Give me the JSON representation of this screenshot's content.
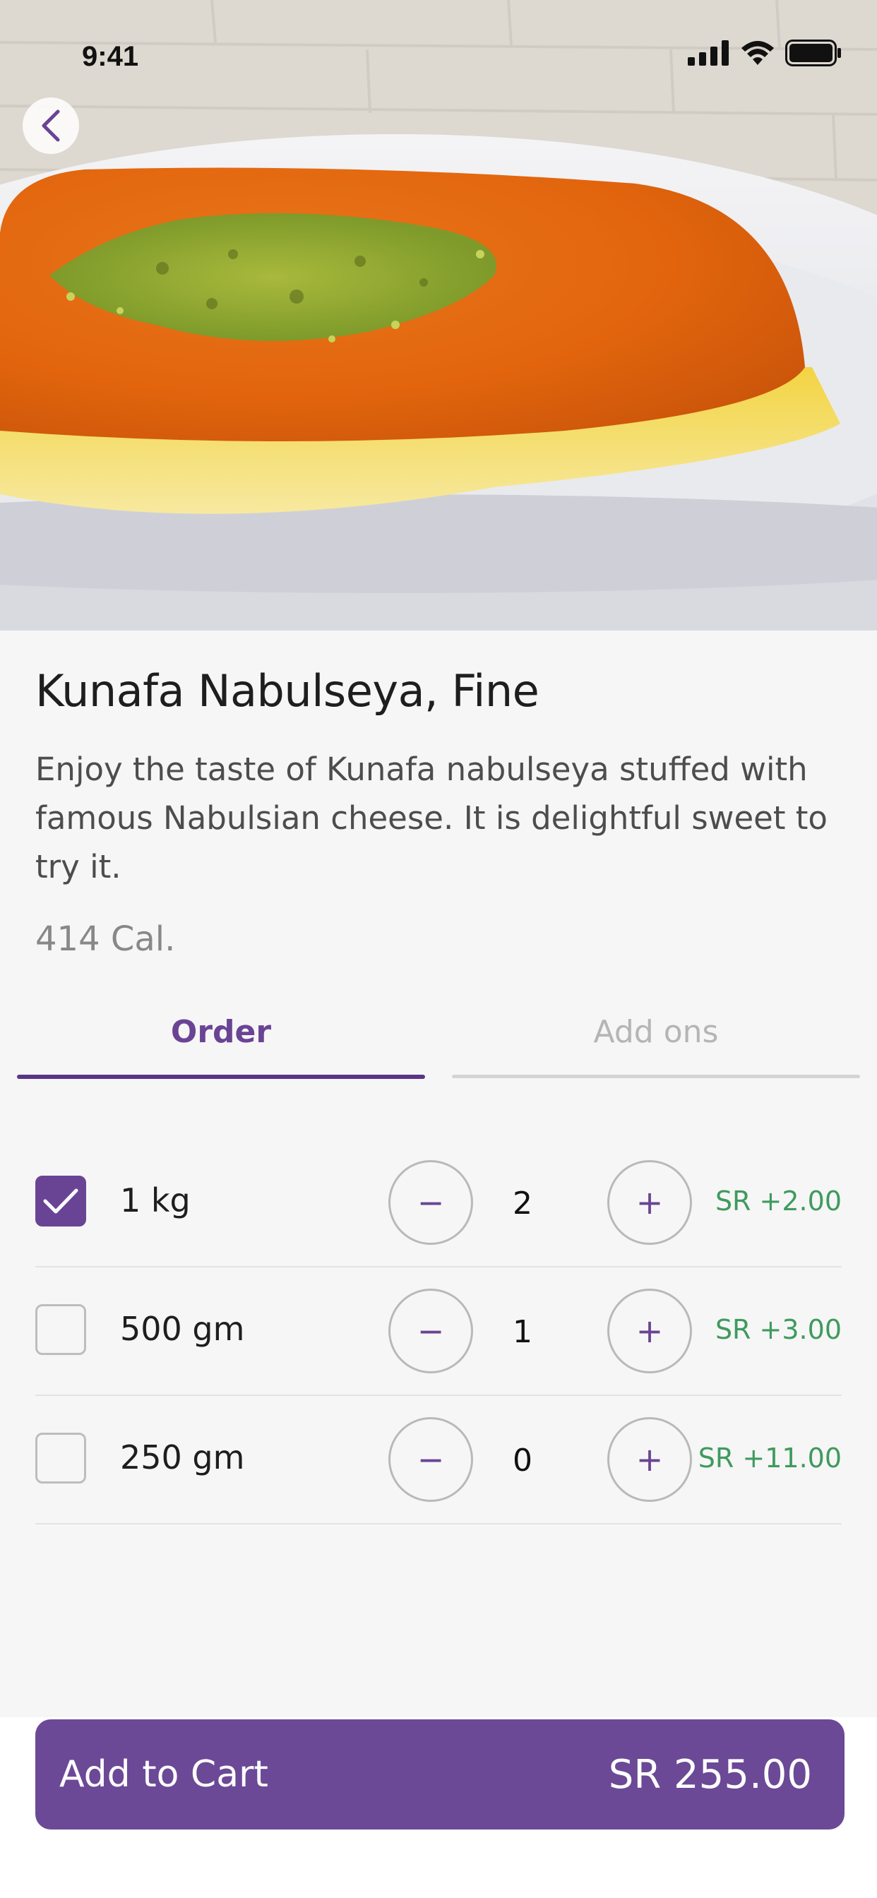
{
  "status_bar": {
    "time": "9:41"
  },
  "product": {
    "title": "Kunafa Nabulseya, Fine",
    "description": "Enjoy the taste of Kunafa nabulseya stuffed with famous  Nabulsian cheese.   It is delightful sweet to try it.",
    "calories": "414 Cal."
  },
  "tabs": [
    {
      "label": "Order",
      "active": true
    },
    {
      "label": "Add ons",
      "active": false
    }
  ],
  "options": [
    {
      "label": "1 kg",
      "checked": true,
      "quantity": "2",
      "price": "SR +2.00"
    },
    {
      "label": "500 gm",
      "checked": false,
      "quantity": "1",
      "price": "SR +3.00"
    },
    {
      "label": "250 gm",
      "checked": false,
      "quantity": "0",
      "price": "SR +11.00"
    }
  ],
  "stepper": {
    "minus": "−",
    "plus": "+"
  },
  "cart": {
    "label": "Add to Cart",
    "total": "SR 255.00"
  },
  "colors": {
    "accent": "#6a4494",
    "button": "#6b4996",
    "price_green": "#3f9a5e",
    "background": "#f6f6f6"
  },
  "icons": [
    "back-chevron-icon",
    "signal-icon",
    "wifi-icon",
    "battery-icon",
    "checkmark-icon"
  ]
}
